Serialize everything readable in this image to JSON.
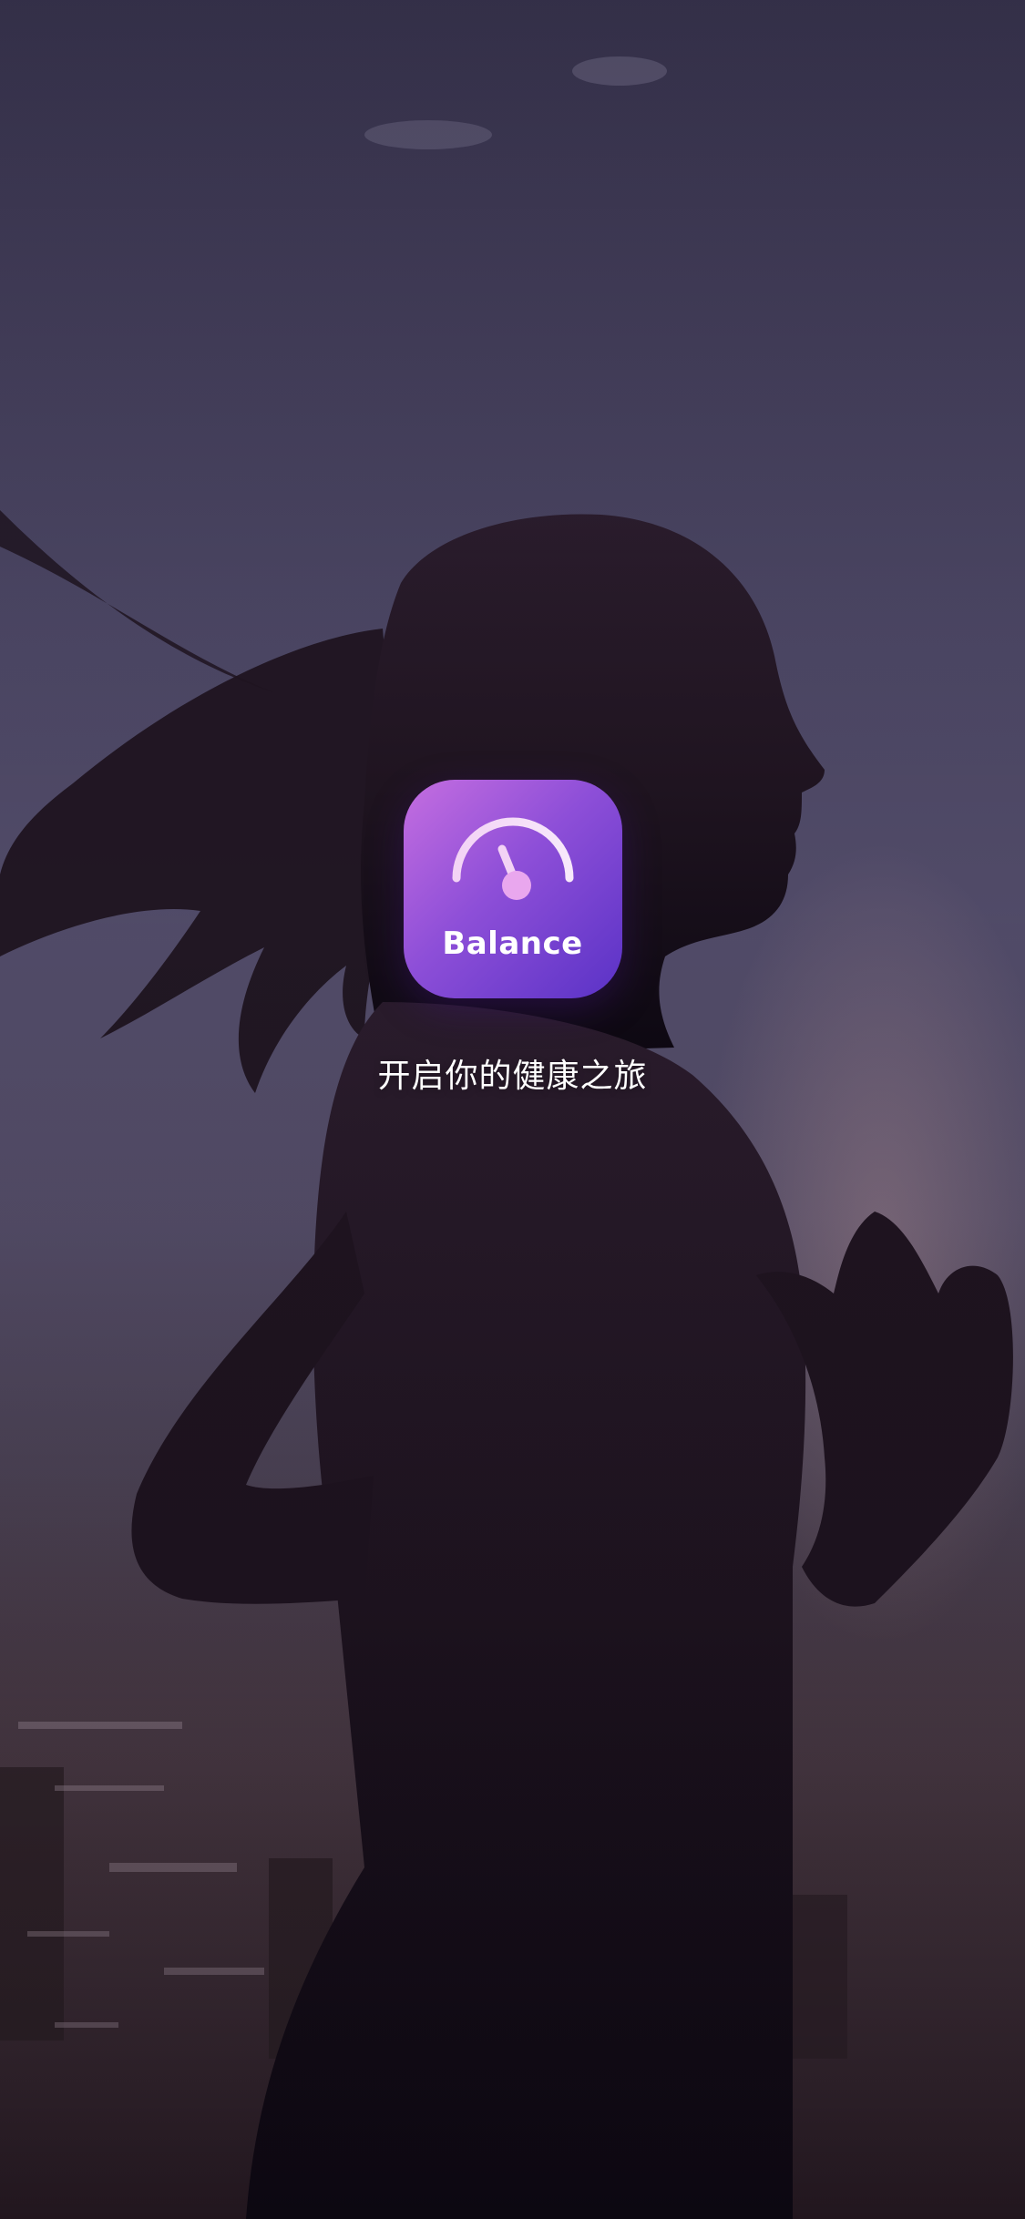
{
  "app": {
    "name": "Balance",
    "icon": "gauge-icon"
  },
  "splash": {
    "tagline": "开启你的健康之旅",
    "background": "runner-silhouette-at-dusk"
  },
  "colors": {
    "icon_gradient_start": "#c56ee0",
    "icon_gradient_mid": "#8e4fd8",
    "icon_gradient_end": "#5a32c6",
    "text": "#ffffff"
  }
}
